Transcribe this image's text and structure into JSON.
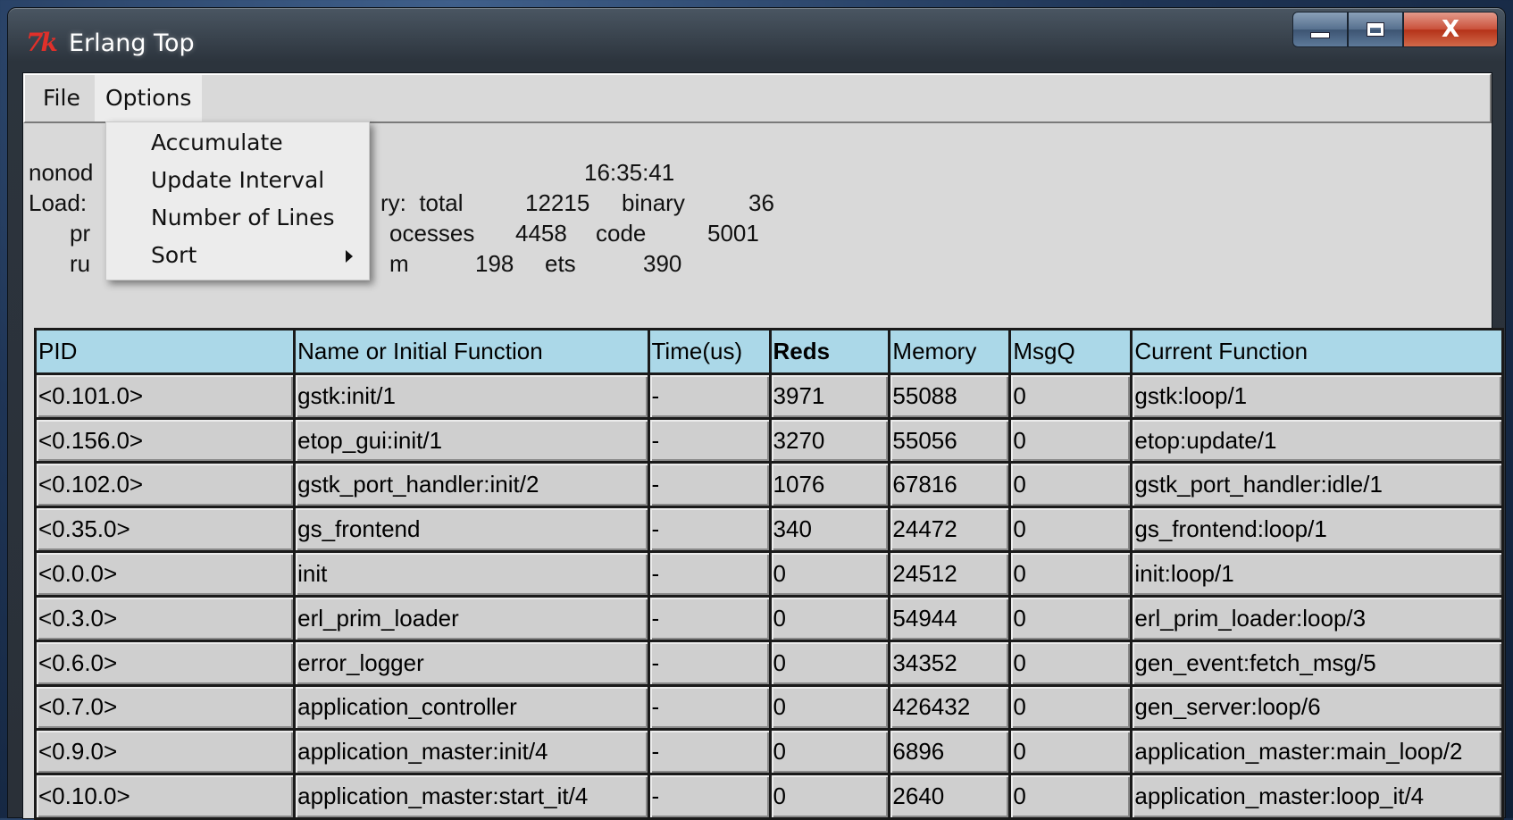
{
  "window": {
    "logo_text": "7k",
    "title": "Erlang Top",
    "close_label": "X",
    "controls": [
      "minimize-button",
      "maximize-button",
      "close-button"
    ]
  },
  "menubar": {
    "items": [
      "File",
      "Options"
    ]
  },
  "options_menu": {
    "items": [
      "Accumulate",
      "Update Interval",
      "Number of Lines",
      "Sort"
    ],
    "submenu_item": "Sort"
  },
  "info": {
    "node_partial": "nonod",
    "load_partial": "Load:",
    "processes_partial": "pr",
    "runqueue_partial": "ru",
    "time": "16:35:41",
    "memory_total_label_partial": "ry:  total",
    "memory_total": "12215",
    "binary_label": "binary",
    "binary": "36",
    "processes_label_partial": "ocesses",
    "processes": "4458",
    "code_label": "code",
    "code": "5001",
    "atom_label_partial": "m",
    "atom": "198",
    "ets_label": "ets",
    "ets": "390"
  },
  "table": {
    "columns": [
      "PID",
      "Name or Initial Function",
      "Time(us)",
      "Reds",
      "Memory",
      "MsgQ",
      "Current Function"
    ],
    "sort_column": "Reds",
    "rows": [
      [
        "<0.101.0>",
        "gstk:init/1",
        "-",
        "3971",
        "55088",
        "0",
        "gstk:loop/1"
      ],
      [
        "<0.156.0>",
        "etop_gui:init/1",
        "-",
        "3270",
        "55056",
        "0",
        "etop:update/1"
      ],
      [
        "<0.102.0>",
        "gstk_port_handler:init/2",
        "-",
        "1076",
        "67816",
        "0",
        "gstk_port_handler:idle/1"
      ],
      [
        "<0.35.0>",
        "gs_frontend",
        "-",
        "340",
        "24472",
        "0",
        "gs_frontend:loop/1"
      ],
      [
        "<0.0.0>",
        "init",
        "-",
        "0",
        "24512",
        "0",
        "init:loop/1"
      ],
      [
        "<0.3.0>",
        "erl_prim_loader",
        "-",
        "0",
        "54944",
        "0",
        "erl_prim_loader:loop/3"
      ],
      [
        "<0.6.0>",
        "error_logger",
        "-",
        "0",
        "34352",
        "0",
        "gen_event:fetch_msg/5"
      ],
      [
        "<0.7.0>",
        "application_controller",
        "-",
        "0",
        "426432",
        "0",
        "gen_server:loop/6"
      ],
      [
        "<0.9.0>",
        "application_master:init/4",
        "-",
        "0",
        "6896",
        "0",
        "application_master:main_loop/2"
      ],
      [
        "<0.10.0>",
        "application_master:start_it/4",
        "-",
        "0",
        "2640",
        "0",
        "application_master:loop_it/4"
      ]
    ]
  }
}
